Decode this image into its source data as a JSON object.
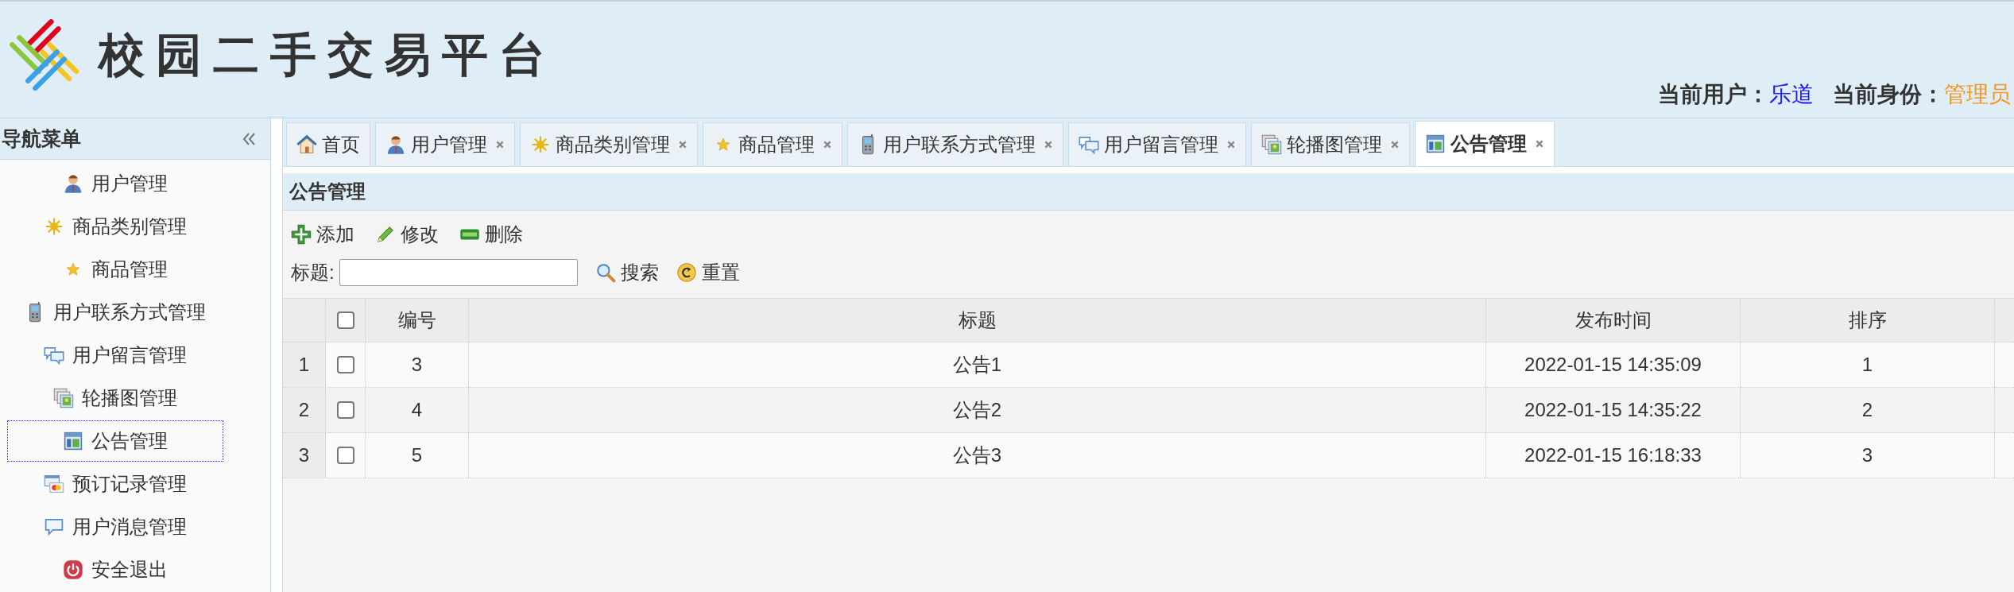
{
  "header": {
    "title": "校园二手交易平台",
    "user_label": "当前用户：",
    "user_name": "乐道",
    "role_label": "当前身份：",
    "role_name": "管理员"
  },
  "sidebar": {
    "title": "导航菜单",
    "items": [
      {
        "label": "用户管理",
        "selected": false
      },
      {
        "label": "商品类别管理",
        "selected": false
      },
      {
        "label": "商品管理",
        "selected": false
      },
      {
        "label": "用户联系方式管理",
        "selected": false
      },
      {
        "label": "用户留言管理",
        "selected": false
      },
      {
        "label": "轮播图管理",
        "selected": false
      },
      {
        "label": "公告管理",
        "selected": true
      },
      {
        "label": "预订记录管理",
        "selected": false
      },
      {
        "label": "用户消息管理",
        "selected": false
      },
      {
        "label": "安全退出",
        "selected": false
      }
    ]
  },
  "tabs": [
    {
      "label": "首页",
      "selected": false,
      "closable": false
    },
    {
      "label": "用户管理",
      "selected": false,
      "closable": true
    },
    {
      "label": "商品类别管理",
      "selected": false,
      "closable": true
    },
    {
      "label": "商品管理",
      "selected": false,
      "closable": true
    },
    {
      "label": "用户联系方式管理",
      "selected": false,
      "closable": true
    },
    {
      "label": "用户留言管理",
      "selected": false,
      "closable": true
    },
    {
      "label": "轮播图管理",
      "selected": false,
      "closable": true
    },
    {
      "label": "公告管理",
      "selected": true,
      "closable": true
    }
  ],
  "panel": {
    "title": "公告管理",
    "toolbar": [
      "添加",
      "修改",
      "删除"
    ],
    "search": {
      "label": "标题:",
      "buttons": [
        "搜索",
        "重置"
      ]
    },
    "table": {
      "columns": [
        "编号",
        "标题",
        "发布时间",
        "排序"
      ],
      "header_checked": false,
      "rows": [
        {
          "index": "1",
          "checked": false,
          "cells": [
            "3",
            "公告1",
            "2022-01-15 14:35:09",
            "1"
          ]
        },
        {
          "index": "2",
          "checked": false,
          "cells": [
            "4",
            "公告2",
            "2022-01-15 14:35:22",
            "2"
          ]
        },
        {
          "index": "3",
          "checked": false,
          "cells": [
            "5",
            "公告3",
            "2022-01-15 16:18:33",
            "3"
          ]
        }
      ]
    }
  }
}
